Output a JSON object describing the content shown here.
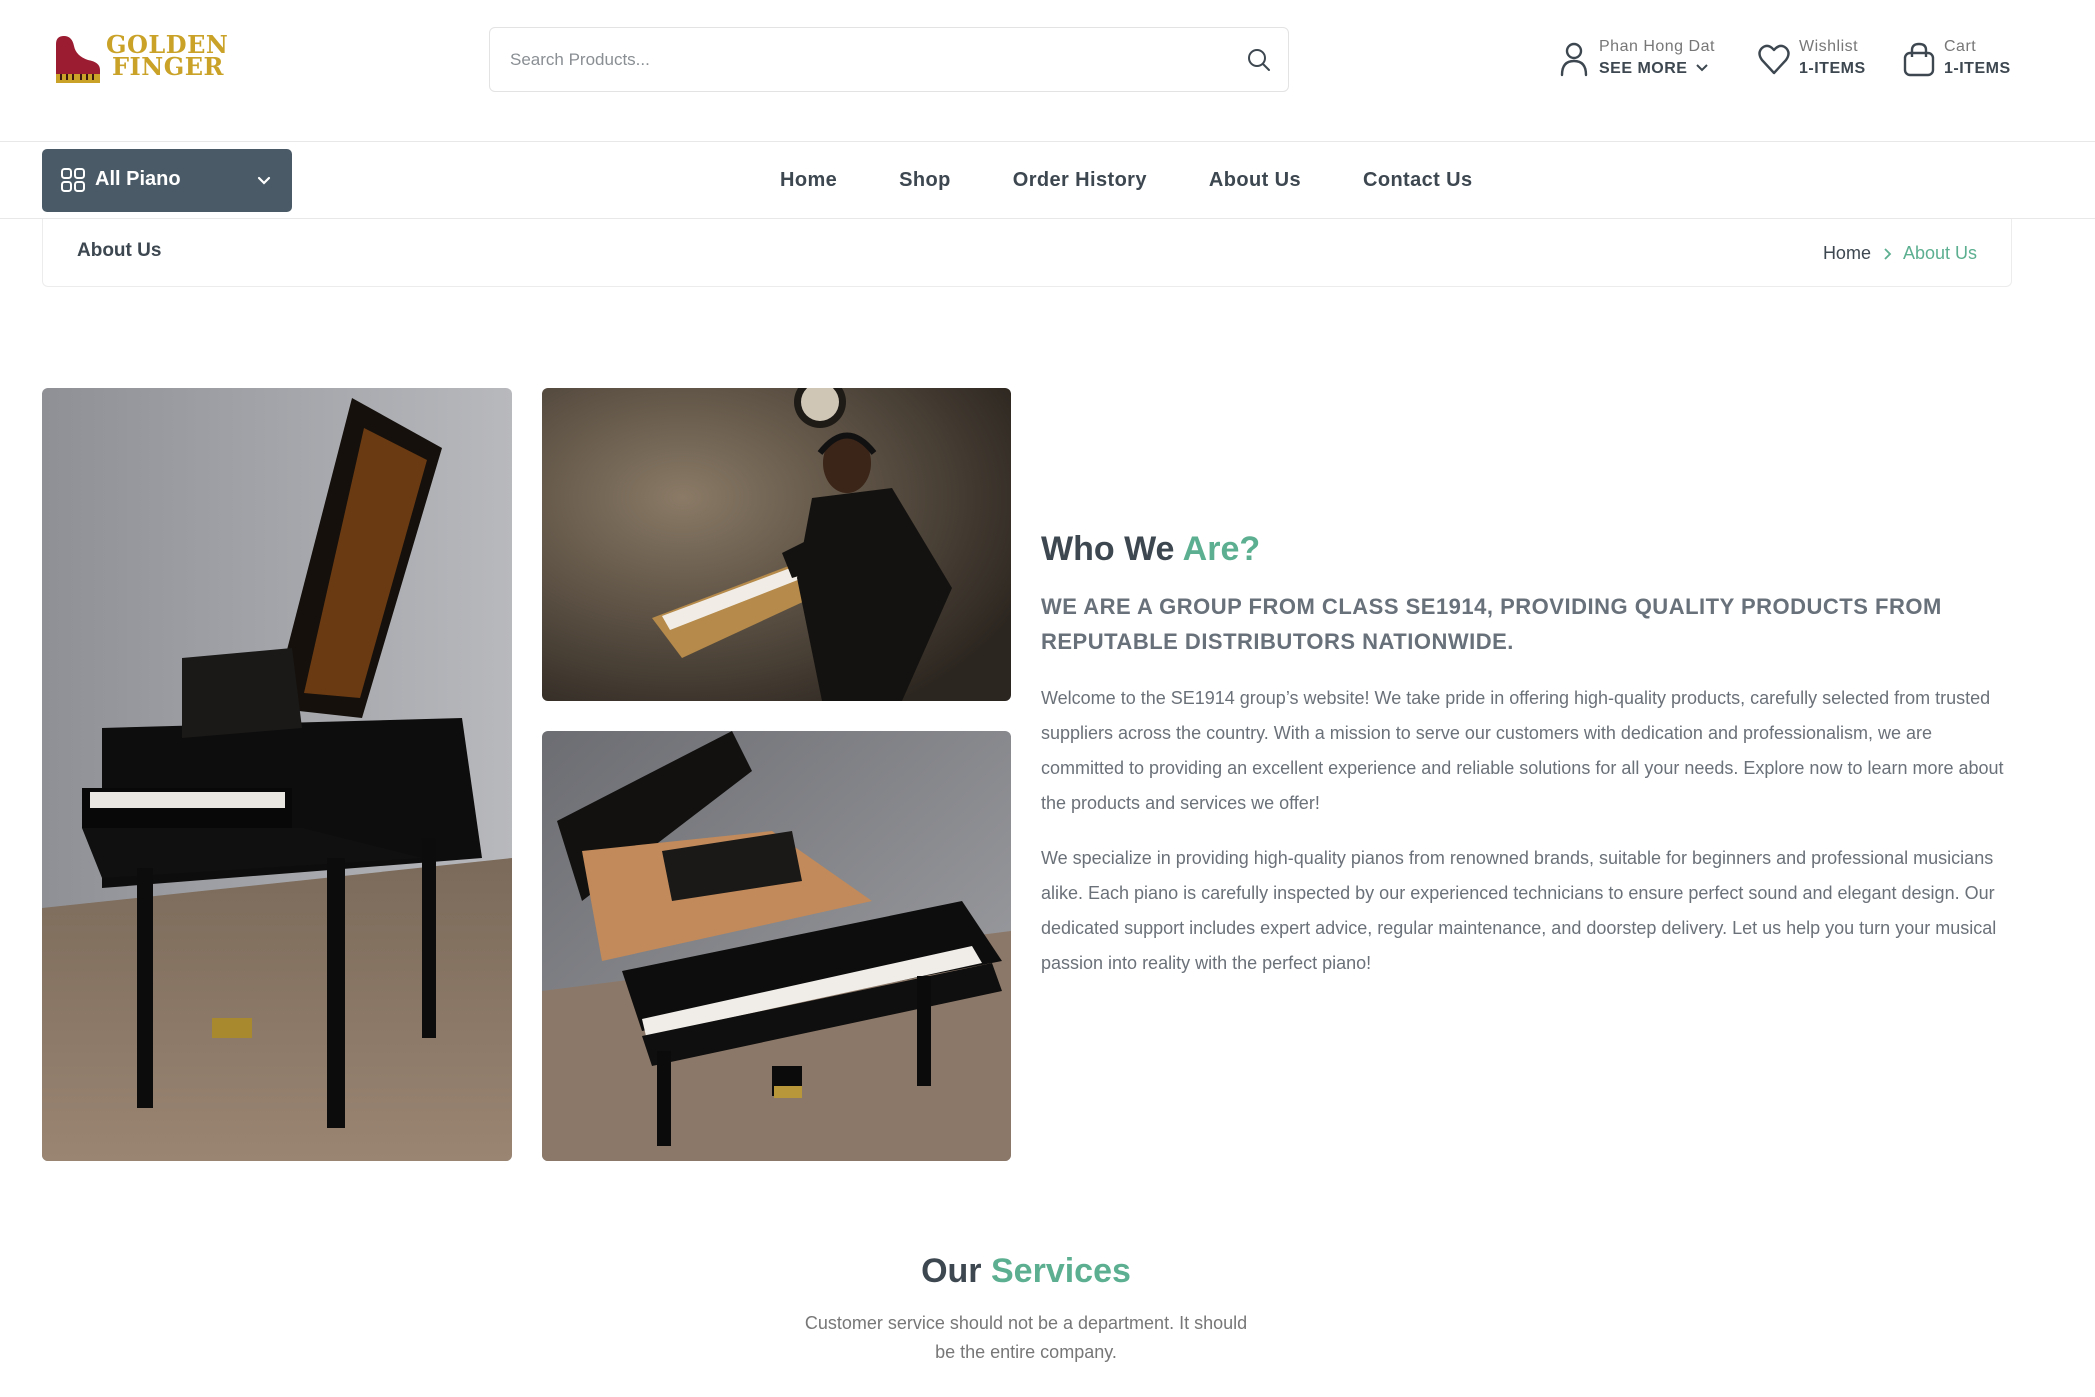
{
  "brand": {
    "line1": "GOLDEN",
    "line2": "FINGER",
    "gold": "#c9a227",
    "crimson": "#9b1b30"
  },
  "colors": {
    "accent": "#5caf90",
    "nav_button": "#4a5a66",
    "text": "#3d4750"
  },
  "search": {
    "placeholder": "Search Products..."
  },
  "header_actions": {
    "user": {
      "icon": "user-icon",
      "line1": "Phan Hong Dat",
      "line2": "SEE MORE"
    },
    "wishlist": {
      "icon": "heart-icon",
      "line1": "Wishlist",
      "line2": "1-ITEMS"
    },
    "cart": {
      "icon": "bag-icon",
      "line1": "Cart",
      "line2": "1-ITEMS"
    }
  },
  "category_button": {
    "label": "All Piano",
    "icon": "grid-icon"
  },
  "nav": {
    "items": [
      "Home",
      "Shop",
      "Order History",
      "About Us",
      "Contact Us"
    ]
  },
  "breadcrumb": {
    "title": "About Us",
    "home": "Home",
    "current": "About Us"
  },
  "about": {
    "title_main": "Who We",
    "title_accent": "Are?",
    "subtitle": "WE ARE A GROUP FROM CLASS SE1914, PROVIDING QUALITY PRODUCTS FROM REPUTABLE DISTRIBUTORS NATIONWIDE.",
    "paragraph1": "Welcome to the SE1914 group’s website! We take pride in offering high-quality products, carefully selected from trusted suppliers across the country. With a mission to serve our customers with dedication and professionalism, we are committed to providing an excellent experience and reliable solutions for all your needs. Explore now to learn more about the products and services we offer!",
    "paragraph2": "We specialize in providing high-quality pianos from renowned brands, suitable for beginners and professional musicians alike. Each piano is carefully inspected by our experienced technicians to ensure perfect sound and elegant design. Our dedicated support includes expert advice, regular maintenance, and doorstep delivery. Let us help you turn your musical passion into reality with the perfect piano!"
  },
  "services": {
    "title_main": "Our",
    "title_accent": "Services",
    "tagline": "Customer service should not be a department. It should be the entire company."
  }
}
